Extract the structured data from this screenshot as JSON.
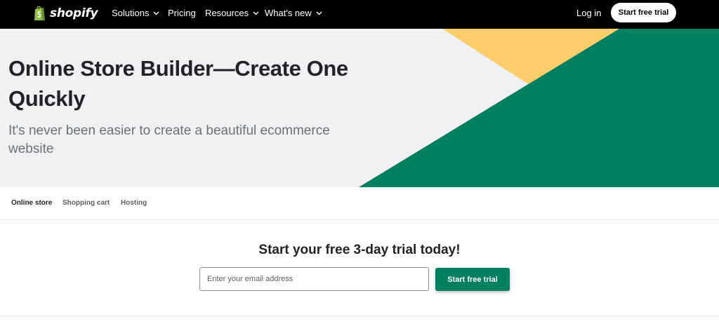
{
  "header": {
    "logo_text": "shopify",
    "nav": [
      {
        "label": "Solutions",
        "has_dropdown": true
      },
      {
        "label": "Pricing",
        "has_dropdown": false
      },
      {
        "label": "Resources",
        "has_dropdown": true
      },
      {
        "label": "What's new",
        "has_dropdown": true
      }
    ],
    "login_label": "Log in",
    "cta_label": "Start free trial"
  },
  "hero": {
    "title": "Online Store Builder—Create One Quickly",
    "subtitle": "It's never been easier to create a beautiful ecommerce website"
  },
  "tabs": [
    {
      "label": "Online store",
      "active": true
    },
    {
      "label": "Shopping cart",
      "active": false
    },
    {
      "label": "Hosting",
      "active": false
    }
  ],
  "signup": {
    "title": "Start your free 3-day trial today!",
    "email_placeholder": "Enter your email address",
    "email_value": "",
    "cta_label": "Start free trial"
  },
  "colors": {
    "nav_bg": "#000000",
    "hero_bg": "#f0f1f2",
    "brand_green": "#008060",
    "hero_yellow": "#fece6c",
    "logo_green": "#95bf47"
  },
  "icons": {
    "logo": "shopify-bag-icon",
    "dropdown": "chevron-down-icon"
  }
}
